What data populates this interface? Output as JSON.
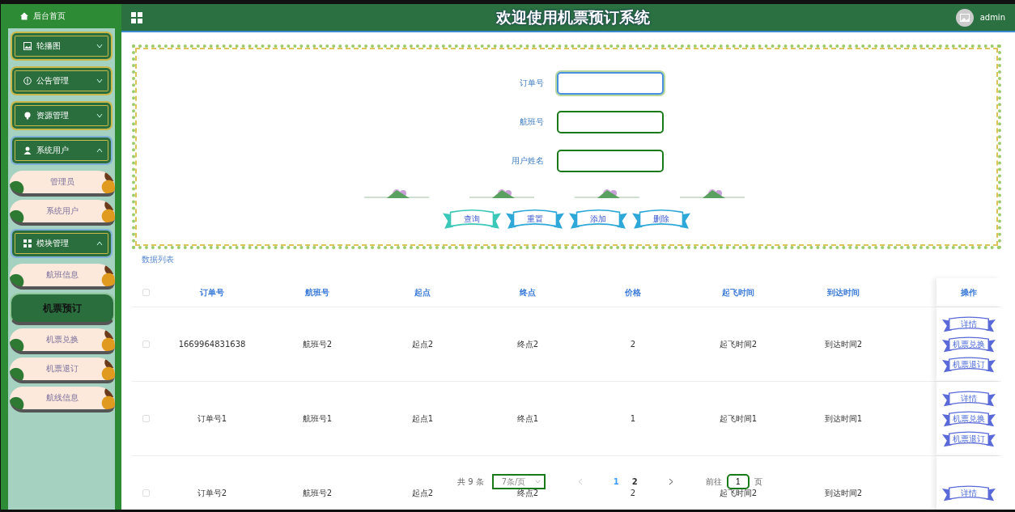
{
  "sidebar": {
    "home": "后台首页",
    "menu": [
      {
        "label": "轮播图",
        "expanded": false
      },
      {
        "label": "公告管理",
        "expanded": false
      },
      {
        "label": "资源管理",
        "expanded": false
      },
      {
        "label": "系统用户",
        "expanded": true,
        "children": [
          {
            "label": "管理员",
            "selected": false
          },
          {
            "label": "系统用户",
            "selected": false
          }
        ]
      },
      {
        "label": "模块管理",
        "expanded": true,
        "children": [
          {
            "label": "航班信息",
            "selected": false
          },
          {
            "label": "机票预订",
            "selected": true
          },
          {
            "label": "机票兑换",
            "selected": false
          },
          {
            "label": "机票退订",
            "selected": false
          },
          {
            "label": "航线信息",
            "selected": false
          }
        ]
      }
    ]
  },
  "header": {
    "title": "欢迎使用机票预订系统",
    "user": "admin"
  },
  "search": {
    "fields": [
      {
        "label": "订单号",
        "focused": true
      },
      {
        "label": "航班号",
        "focused": false
      },
      {
        "label": "用户姓名",
        "focused": false
      }
    ],
    "buttons": [
      "查询",
      "重置",
      "添加",
      "删除"
    ]
  },
  "list_title": "数据列表",
  "table": {
    "select_all_checked": false,
    "columns": [
      "订单号",
      "航班号",
      "起点",
      "终点",
      "价格",
      "起飞时间",
      "到达时间"
    ],
    "action_column": "操作",
    "rows": [
      {
        "checked": false,
        "cells": [
          "1669964831638",
          "航班号2",
          "起点2",
          "终点2",
          "2",
          "起飞时间2",
          "到达时间2"
        ],
        "actions": [
          "详情",
          "机票兑换",
          "机票退订"
        ]
      },
      {
        "checked": false,
        "cells": [
          "订单号1",
          "航班号1",
          "起点1",
          "终点1",
          "1",
          "起飞时间1",
          "到达时间1"
        ],
        "actions": [
          "详情",
          "机票兑换",
          "机票退订"
        ]
      },
      {
        "checked": false,
        "cells": [
          "订单号2",
          "航班号2",
          "起点2",
          "终点2",
          "2",
          "起飞时间2",
          "到达时间2"
        ],
        "actions": [
          "详情"
        ]
      }
    ]
  },
  "pagination": {
    "total": "共 9 条",
    "page_size": "7条/页",
    "pages": [
      {
        "label": "1",
        "selected": true
      },
      {
        "label": "2",
        "selected": false
      }
    ],
    "goto_label": "前往",
    "goto_value": "1",
    "goto_suffix": "页"
  }
}
